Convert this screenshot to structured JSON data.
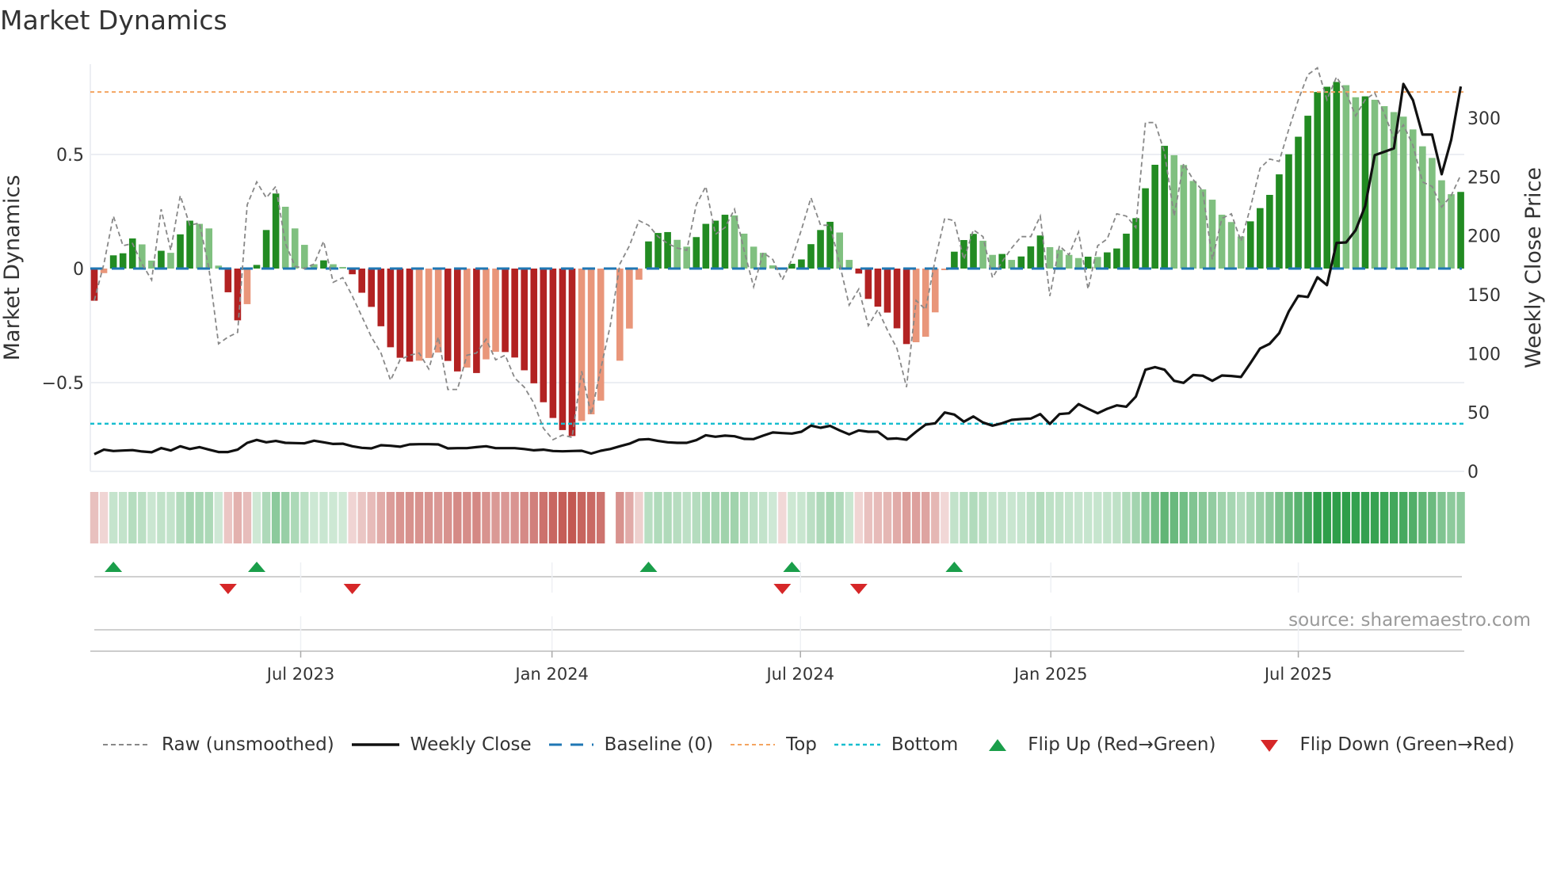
{
  "title": "Market Dynamics",
  "source": "source: sharemaestro.com",
  "colors": {
    "bar_up_strong": "#228b22",
    "bar_up_weak": "#80c080",
    "bar_down_strong": "#b22222",
    "bar_down_weak": "#e9967a",
    "raw": "#888888",
    "close": "#111111",
    "baseline": "#1f77b4",
    "top": "#f4a460",
    "bottom": "#17becf",
    "flip_up": "#1a9e4a",
    "flip_down": "#d62728",
    "heat_green": "#2e9e4a",
    "heat_red": "#c0504a",
    "grid": "#eceef3"
  },
  "legend": [
    {
      "key": "raw",
      "label": "Raw (unsmoothed)"
    },
    {
      "key": "close",
      "label": "Weekly Close"
    },
    {
      "key": "baseline",
      "label": "Baseline (0)"
    },
    {
      "key": "top",
      "label": "Top"
    },
    {
      "key": "bottom",
      "label": "Bottom"
    },
    {
      "key": "flip_up",
      "label": "Flip Up (Red→Green)"
    },
    {
      "key": "flip_down",
      "label": "Flip Down (Green→Red)"
    }
  ],
  "chart_data": {
    "type": "bar",
    "title": "Market Dynamics",
    "ylabel": "Market Dynamics",
    "y2label": "Weekly Close Price",
    "ylim": [
      -0.889,
      0.896
    ],
    "y2lim": [
      0,
      345.7
    ],
    "grid": true,
    "legend_position": "bottom",
    "top_level": 0.774,
    "bottom_level": -0.68,
    "baseline": 0,
    "yticks": [
      {
        "value": 0.5,
        "label": "0.5"
      },
      {
        "value": 0,
        "label": "0"
      },
      {
        "value": -0.5,
        "label": "−0.5"
      }
    ],
    "y2ticks": [
      {
        "value": 0,
        "label": "0"
      },
      {
        "value": 50,
        "label": "50"
      },
      {
        "value": 100,
        "label": "100"
      },
      {
        "value": 150,
        "label": "150"
      },
      {
        "value": 200,
        "label": "200"
      },
      {
        "value": 250,
        "label": "250"
      },
      {
        "value": 300,
        "label": "300"
      }
    ],
    "xticks": [
      {
        "week": 21.6,
        "label": "Jul 2023"
      },
      {
        "week": 47.9,
        "label": "Jan 2024"
      },
      {
        "week": 73.9,
        "label": "Jul 2024"
      },
      {
        "week": 100.1,
        "label": "Jan 2025"
      },
      {
        "week": 126.0,
        "label": "Jul 2025"
      }
    ],
    "values": [
      -0.141,
      -0.02,
      0.058,
      0.067,
      0.132,
      0.106,
      0.035,
      0.078,
      0.069,
      0.15,
      0.21,
      0.196,
      0.176,
      0.013,
      -0.104,
      -0.227,
      -0.156,
      0.016,
      0.169,
      0.329,
      0.271,
      0.176,
      0.104,
      0.019,
      0.036,
      0.019,
      0.007,
      -0.025,
      -0.106,
      -0.168,
      -0.253,
      -0.345,
      -0.391,
      -0.408,
      -0.404,
      -0.392,
      -0.368,
      -0.405,
      -0.451,
      -0.434,
      -0.458,
      -0.398,
      -0.365,
      -0.366,
      -0.39,
      -0.446,
      -0.503,
      -0.586,
      -0.655,
      -0.708,
      -0.734,
      -0.668,
      -0.639,
      -0.579,
      null,
      -0.404,
      -0.263,
      -0.049,
      0.119,
      0.156,
      0.16,
      0.126,
      0.096,
      0.138,
      0.196,
      0.21,
      0.236,
      0.233,
      0.153,
      0.096,
      0.069,
      0.014,
      -0.003,
      0.021,
      0.04,
      0.107,
      0.169,
      0.205,
      0.158,
      0.038,
      -0.022,
      -0.133,
      -0.167,
      -0.193,
      -0.262,
      -0.331,
      -0.323,
      -0.299,
      -0.192,
      -0.007,
      0.074,
      0.125,
      0.152,
      0.122,
      0.06,
      0.064,
      0.038,
      0.053,
      0.097,
      0.145,
      0.094,
      0.082,
      0.06,
      0.046,
      0.052,
      0.051,
      0.071,
      0.088,
      0.153,
      0.221,
      0.352,
      0.455,
      0.538,
      0.497,
      0.454,
      0.384,
      0.347,
      0.302,
      0.236,
      0.204,
      0.141,
      0.207,
      0.265,
      0.323,
      0.413,
      0.501,
      0.578,
      0.67,
      0.774,
      0.797,
      0.818,
      0.804,
      0.751,
      0.755,
      0.74,
      0.712,
      0.686,
      0.666,
      0.61,
      0.536,
      0.485,
      0.387,
      0.326,
      0.336
    ],
    "raw": [
      -0.14,
      0.02,
      0.23,
      0.1,
      0.11,
      0.02,
      -0.05,
      0.26,
      0.08,
      0.32,
      0.19,
      0.2,
      0,
      -0.33,
      -0.3,
      -0.28,
      0.28,
      0.38,
      0.31,
      0.36,
      0.11,
      0.01,
      0,
      0.02,
      0.12,
      -0.06,
      -0.04,
      -0.12,
      -0.21,
      -0.3,
      -0.37,
      -0.49,
      -0.4,
      -0.38,
      -0.37,
      -0.44,
      -0.3,
      -0.53,
      -0.53,
      -0.38,
      -0.37,
      -0.31,
      -0.4,
      -0.38,
      -0.48,
      -0.52,
      -0.59,
      -0.7,
      -0.75,
      -0.73,
      -0.74,
      -0.45,
      -0.64,
      -0.44,
      -0.25,
      0.02,
      0.1,
      0.21,
      0.19,
      0.14,
      0.11,
      0.09,
      0.08,
      0.28,
      0.36,
      0.15,
      0.18,
      0.26,
      0.08,
      -0.08,
      0.07,
      0.04,
      -0.05,
      0.04,
      0.17,
      0.31,
      0.19,
      0.19,
      0.02,
      -0.16,
      -0.09,
      -0.25,
      -0.18,
      -0.27,
      -0.35,
      -0.52,
      -0.14,
      -0.18,
      0.04,
      0.22,
      0.21,
      0.04,
      0.17,
      0.14,
      -0.04,
      0.03,
      0.09,
      0.14,
      0.14,
      0.23,
      -0.12,
      0.1,
      0.06,
      0.16,
      -0.09,
      0.1,
      0.13,
      0.24,
      0.23,
      0.18,
      0.64,
      0.64,
      0.51,
      0.23,
      0.46,
      0.39,
      0.34,
      0.04,
      0.22,
      0.24,
      0.12,
      0.27,
      0.44,
      0.48,
      0.47,
      0.61,
      0.74,
      0.85,
      0.88,
      0.74,
      0.84,
      0.77,
      0.67,
      0.74,
      0.77,
      0.68,
      0.57,
      0.63,
      0.54,
      0.38,
      0.36,
      0.27,
      0.32,
      0.41
    ],
    "close": [
      14.6,
      18.4,
      17.3,
      17.7,
      18,
      16.9,
      16.2,
      19.8,
      17.7,
      21.3,
      19,
      20.6,
      18.4,
      16.4,
      16.4,
      18.4,
      24.2,
      26.7,
      24.7,
      25.8,
      24.2,
      24,
      23.8,
      26,
      24.7,
      23.3,
      23.5,
      21.3,
      20,
      19.5,
      22.2,
      21.7,
      20.9,
      22.9,
      23.1,
      23.1,
      22.9,
      19.5,
      19.7,
      19.7,
      20.6,
      21.3,
      19.7,
      19.7,
      19.7,
      19,
      17.9,
      18.4,
      17.3,
      17,
      17.3,
      17.5,
      15.1,
      17.5,
      19,
      21.3,
      23.5,
      26.9,
      27.4,
      25.8,
      24.7,
      24.2,
      24.2,
      26.5,
      30.7,
      29.4,
      30.3,
      29.8,
      27.6,
      27.4,
      30.3,
      33,
      32.5,
      32.1,
      33.6,
      38.8,
      37,
      38.6,
      34.8,
      31.4,
      34.8,
      33.6,
      33.6,
      27.6,
      28,
      26.9,
      33.6,
      39.7,
      40.8,
      50,
      48.2,
      42.2,
      46.6,
      41.5,
      38.8,
      40.8,
      43.7,
      44.4,
      44.8,
      48.6,
      40.3,
      48.6,
      49.3,
      57.1,
      53.1,
      49.3,
      53.1,
      56,
      54.9,
      63.4,
      86.3,
      88.5,
      86.3,
      76.9,
      75.1,
      81.8,
      81.2,
      76.9,
      81.4,
      81,
      80.1,
      92,
      104.3,
      108.3,
      117.3,
      135.7,
      149.1,
      148,
      164.8,
      158.1,
      194,
      194.4,
      204.7,
      225.3,
      268.4,
      271.3,
      274.2,
      328.9,
      315,
      285.9,
      285.9,
      252.3,
      281.4,
      326.7
    ],
    "flip_up_weeks": [
      2,
      17,
      58,
      73,
      90
    ],
    "flip_down_weeks": [
      14,
      27,
      72,
      80
    ]
  }
}
